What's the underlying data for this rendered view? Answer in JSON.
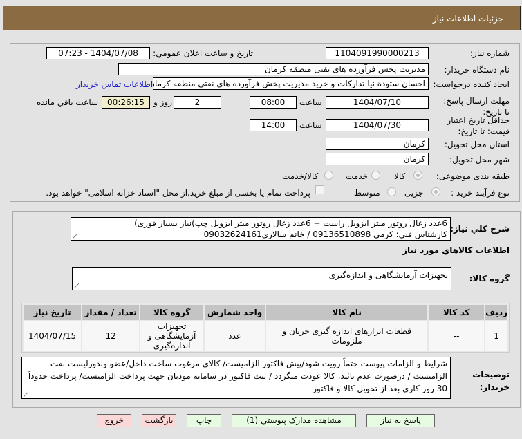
{
  "header": {
    "title": "جزئیات اطلاعات نیاز"
  },
  "form": {
    "need_number_label": "شماره نیاز:",
    "need_number": "1104091990000213",
    "announce_label": "تاريخ و ساعت اعلان عمومي:",
    "announce_value": "1404/07/08 - 07:23",
    "buyer_label": "نام دستگاه خریدار:",
    "buyer": "مدیریت پخش فرآورده های نفتی منطقه کرمان",
    "creator_label": "ایجاد کننده درخواست:",
    "creator": "احسان  ستودة نیا  تدارکات و خرید  مدیریت پخش فرآورده های نفتی منطقه کرمان",
    "contact_link": "اطلاعات تماس خریدار",
    "deadline_label": "مهلت ارسال پاسخ: تا تاریخ:",
    "deadline_date": "1404/07/10",
    "time_label": "ساعت",
    "deadline_time": "08:00",
    "days": "2",
    "days_suffix": "روز و",
    "remaining": "00:26:15",
    "remaining_suffix": "ساعت باقي مانده",
    "validity_label": "حداقل تاریخ اعتبار قیمت: تا تاریخ:",
    "validity_date": "1404/07/30",
    "validity_time": "14:00",
    "province_label": "استان محل تحویل:",
    "province": "کرمان",
    "city_label": "شهر محل تحویل:",
    "city": "کرمان",
    "category_label": "طبقه بندی موضوعی:",
    "category_options": [
      "کالا",
      "خدمت",
      "کالا/خدمت"
    ],
    "purchase_label": "نوع فرآیند خرید :",
    "purchase_options": [
      "جزیی",
      "متوسط"
    ],
    "payment_note": "پرداخت تمام یا بخشی از مبلغ خرید،از محل \"اسناد خزانه اسلامی\" خواهد بود."
  },
  "details": {
    "desc_label": "شرح كلي نياز:",
    "desc_line1": "6عدد زغال روتور میتر ایزوبل راست + 6عدد زغال روتور میتر ایزوبل چپ)نیاز بسیار فوری)",
    "desc_line2": "کارشناس فنی: کرمی 09136510898 / خانم سالاری09032624161",
    "goods_heading": "اطلاعات كالاهاي مورد نياز",
    "group_label": "گروه کالا:",
    "group": "تجهیزات آزمایشگاهی و اندازه‌گیری",
    "table": {
      "headers": [
        "ردیف",
        "کد کالا",
        "نام کالا",
        "واحد شمارش",
        "گروه کالا",
        "تعداد / مقدار",
        "تاریخ نیاز"
      ],
      "rows": [
        [
          "1",
          "--",
          "قطعات ابزارهای اندازه گیری جریان و ملزومات",
          "عدد",
          "تجهیزات آزمایشگاهی و اندازه‌گیری",
          "12",
          "1404/07/15"
        ]
      ]
    },
    "notes_label": "توضیحات خریدار:",
    "notes": "شرایط و الزامات پیوست حتماً رویت شود/پیش فاکتور الزامیست/ کالای مرغوب ساخت داخل/عضو وندورلیست نفت الزامیست / درصورت عدم تائید، کالا عودت میگردد / ثبت فاکتور در سامانه مودیان جهت پرداخت الزامیست/ پرداخت حدوداً 30 روز کاری بعد از تحویل کالا و فاکتور"
  },
  "buttons": {
    "reply": "پاسخ به نياز",
    "attachments": "مشاهده مدارک پیوستي (1)",
    "print": "چاپ",
    "back": "بازگشت",
    "exit": "خروج"
  }
}
